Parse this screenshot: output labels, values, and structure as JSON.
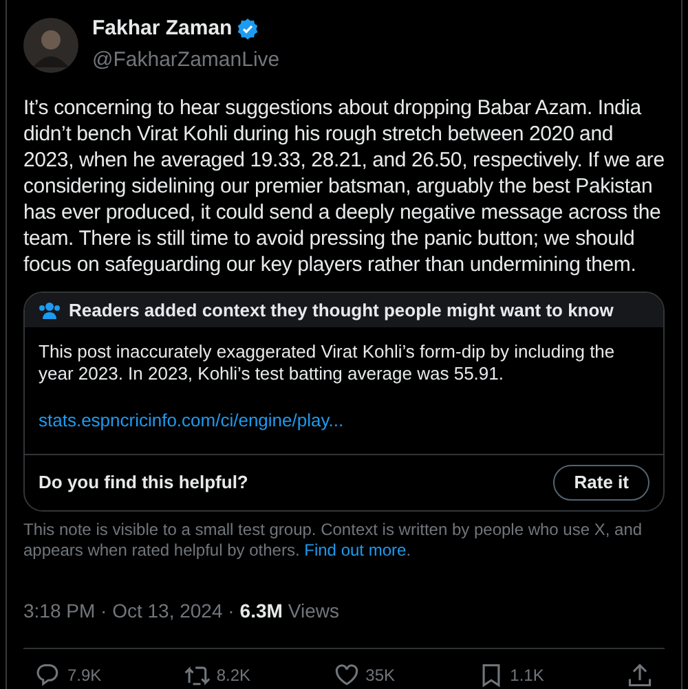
{
  "author": {
    "name": "Fakhar Zaman",
    "verified": true,
    "handle": "@FakharZamanLive"
  },
  "text": "It’s concerning to hear suggestions about dropping Babar Azam. India didn’t bench Virat Kohli during his rough stretch between 2020 and 2023, when he averaged 19.33, 28.21, and 26.50, respectively. If we are considering sidelining our premier batsman, arguably the best Pakistan has ever produced, it could send a deeply negative message across the team. There is still time to avoid pressing the panic button; we should focus on safeguarding our key players rather than undermining them.",
  "community_note": {
    "title": "Readers added context they thought people might want to know",
    "body": "This post inaccurately exaggerated Virat Kohli’s form-dip by including the year 2023. In 2023, Kohli’s test batting average was 55.91.",
    "link": "stats.espncricinfo.com/ci/engine/play...",
    "question": "Do you find this helpful?",
    "button": "Rate it",
    "disclaimer": "This note is visible to a small test group. Context is written by people who use X, and appears when rated helpful by others.",
    "disclaimer_link": "Find out more",
    "disclaimer_end": "."
  },
  "timestamp": "3:18 PM · Oct 13, 2024 ·",
  "views_count": "6.3M",
  "views_label": "Views",
  "actions": [
    {
      "kind": "reply",
      "count": "7.9K"
    },
    {
      "kind": "repost",
      "count": "8.2K"
    },
    {
      "kind": "like",
      "count": "35K"
    },
    {
      "kind": "bookmark",
      "count": "1.1K"
    },
    {
      "kind": "share"
    }
  ]
}
